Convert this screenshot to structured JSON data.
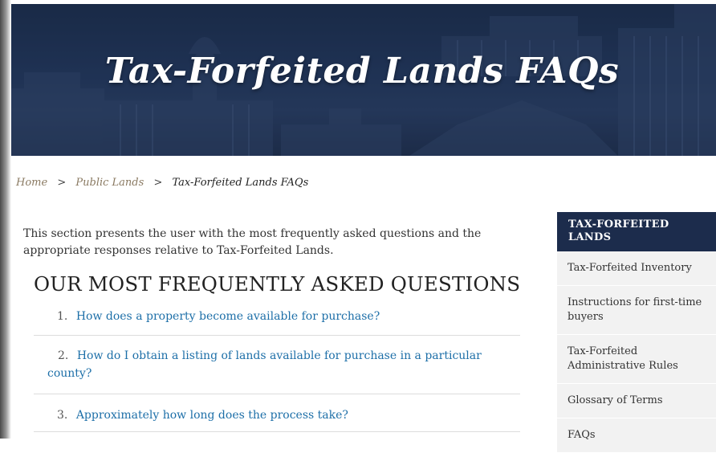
{
  "hero": {
    "title": "Tax-Forfeited Lands FAQs"
  },
  "breadcrumb": {
    "home": "Home",
    "separator": ">",
    "public_lands": "Public Lands",
    "current": "Tax-Forfeited Lands FAQs"
  },
  "intro": "This section presents the user with the most frequently asked questions and the appropriate responses relative to Tax-Forfeited Lands.",
  "faq": {
    "heading": "OUR MOST FREQUENTLY ASKED QUESTIONS",
    "items": [
      {
        "number": "1.",
        "question": "How does a property become available for purchase?"
      },
      {
        "number": "2.",
        "question": "How do I obtain a listing of lands available for purchase in a particular county?"
      },
      {
        "number": "3.",
        "question": "Approximately how long does the process take?"
      }
    ]
  },
  "sidebar": {
    "header": "TAX-FORFEITED LANDS",
    "items": [
      {
        "label": "Tax-Forfeited Inventory"
      },
      {
        "label": "Instructions for first-time buyers"
      },
      {
        "label": "Tax-Forfeited Administrative Rules"
      },
      {
        "label": "Glossary of Terms"
      },
      {
        "label": "FAQs"
      }
    ]
  },
  "colors": {
    "hero_bg": "#1c2c4c",
    "link": "#1d6fa8",
    "breadcrumb_link": "#8a7a62",
    "sidebar_header": "#1c2c4c",
    "sidebar_item_bg": "#f2f2f2"
  }
}
